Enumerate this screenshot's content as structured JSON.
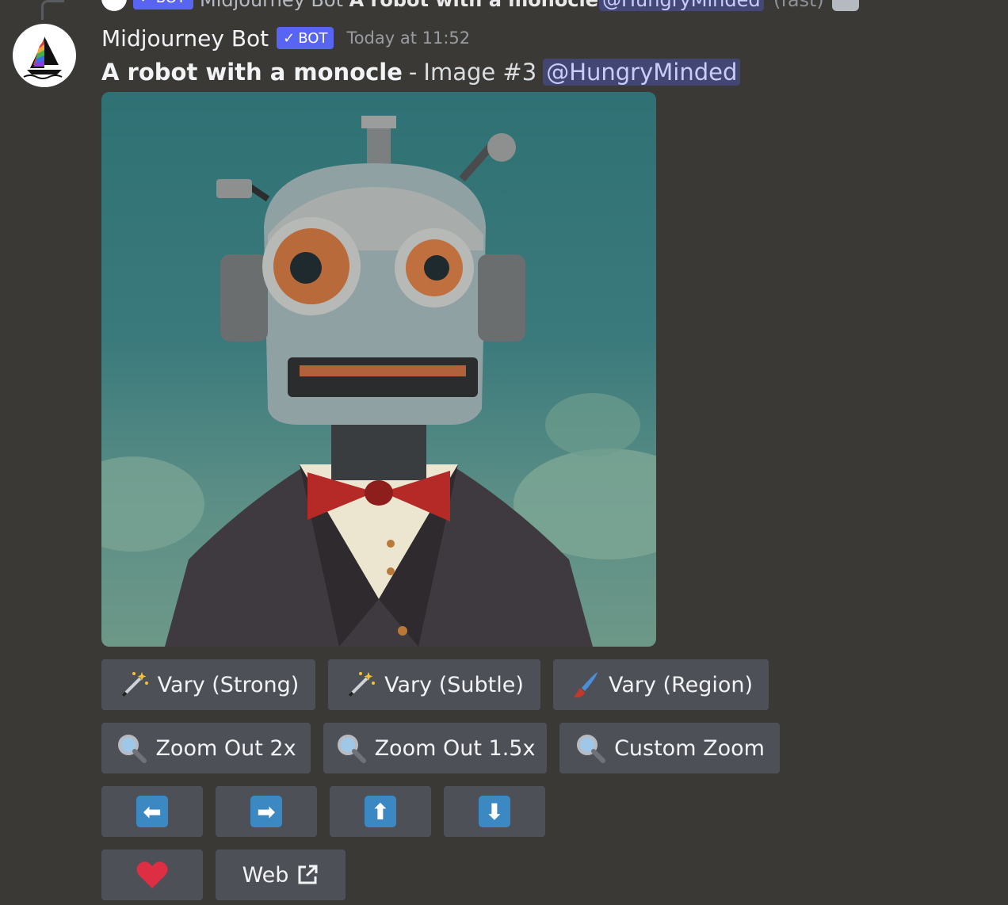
{
  "reply": {
    "badge": "✓ BOT",
    "author": "Midjourney Bot",
    "prompt": "A robot with a monocle",
    "mention": "@HungryMinded",
    "extra": "(fast)"
  },
  "message": {
    "username": "Midjourney Bot",
    "bot_badge": "BOT",
    "timestamp": "Today at 11:52",
    "prompt": "A robot with a monocle",
    "separator": "-",
    "image_label": "Image #3",
    "mention": "@HungryMinded"
  },
  "image": {
    "alt": "robot with monocle artwork"
  },
  "buttons": {
    "row1": [
      {
        "icon": "magic-wand-icon",
        "label": "Vary (Strong)"
      },
      {
        "icon": "magic-wand-icon",
        "label": "Vary (Subtle)"
      },
      {
        "icon": "paintbrush-icon",
        "label": "Vary (Region)"
      }
    ],
    "row2": [
      {
        "icon": "magnifier-icon",
        "label": "Zoom Out 2x"
      },
      {
        "icon": "magnifier-icon",
        "label": "Zoom Out 1.5x"
      },
      {
        "icon": "magnifier-icon",
        "label": "Custom Zoom"
      }
    ],
    "row3": [
      {
        "icon": "arrow-left-icon",
        "glyph": "⬅"
      },
      {
        "icon": "arrow-right-icon",
        "glyph": "➡"
      },
      {
        "icon": "arrow-up-icon",
        "glyph": "⬆"
      },
      {
        "icon": "arrow-down-icon",
        "glyph": "⬇"
      }
    ],
    "row4": [
      {
        "icon": "heart-icon",
        "glyph": "❤"
      },
      {
        "icon": "external-link-icon",
        "label": "Web"
      }
    ]
  },
  "colors": {
    "background": "#3a3936",
    "button": "#4e5058",
    "bot_badge": "#5865f2",
    "arrow": "#3b88c3",
    "heart": "#dd2e44"
  }
}
